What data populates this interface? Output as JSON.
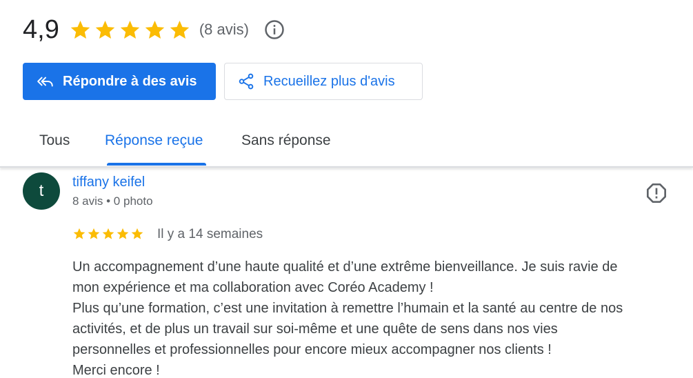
{
  "summary": {
    "rating": "4,9",
    "stars": 5,
    "review_count": "(8 avis)",
    "star_color": "#fbbc04",
    "info_icon": "info-icon"
  },
  "actions": {
    "reply_label": "Répondre à des avis",
    "reply_icon": "reply-all-icon",
    "collect_label": "Recueillez plus d'avis",
    "collect_icon": "share-icon",
    "accent": "#1a73e8"
  },
  "tabs": [
    {
      "label": "Tous",
      "active": false
    },
    {
      "label": "Réponse reçue",
      "active": true
    },
    {
      "label": "Sans réponse",
      "active": false
    }
  ],
  "review": {
    "avatar_letter": "t",
    "avatar_color": "#0e4a3c",
    "name": "tiffany keifel",
    "meta": "8 avis • 0 photo",
    "stars": 5,
    "date": "Il y a 14 semaines",
    "flag_icon": "report-icon",
    "lines": [
      "Un accompagnement d’une haute qualité et d’une extrême bienveillance. Je suis ravie de",
      "mon expérience et ma collaboration avec Coréo Academy !",
      "Plus qu’une formation, c’est une invitation à remettre l’humain et la santé au centre de nos",
      "activités, et de plus un travail sur soi-même et une quête de sens dans nos vies",
      "personnelles et professionnelles pour encore mieux accompagner nos clients !",
      "Merci encore !"
    ]
  }
}
